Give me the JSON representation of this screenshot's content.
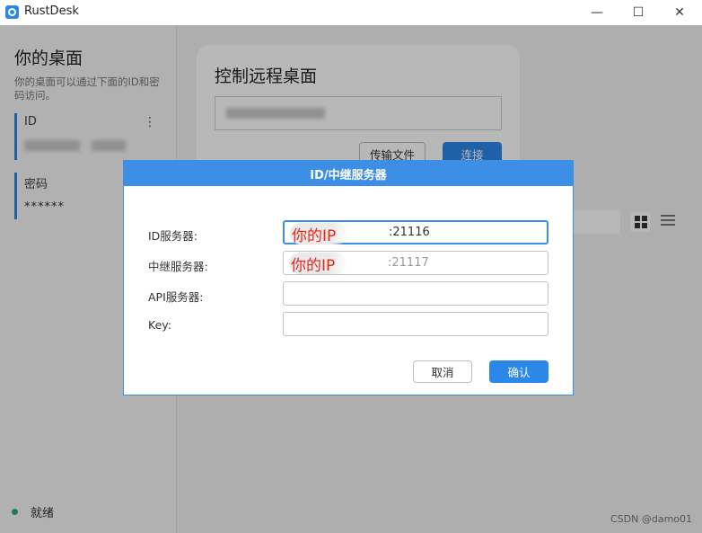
{
  "window": {
    "title": "RustDesk",
    "controls": {
      "minimize": "—",
      "maximize": "☐",
      "close": "✕"
    }
  },
  "left_panel": {
    "title": "你的桌面",
    "description": "你的桌面可以通过下面的ID和密码访问。",
    "id_label": "ID",
    "menu_icon": "⋮",
    "password_label": "密码",
    "password_value": "******"
  },
  "remote_card": {
    "title": "控制远程桌面",
    "transfer_button": "传输文件",
    "connect_button": "连接"
  },
  "status": {
    "text": "就绪",
    "color": "#2aa88a"
  },
  "watermark": "CSDN @damo01",
  "dialog": {
    "title": "ID/中继服务器",
    "rows": [
      {
        "label": "ID服务器:",
        "overlay": "你的IP",
        "port": ":21116",
        "focused": true
      },
      {
        "label": "中继服务器:",
        "overlay": "你的IP",
        "port": ":21117",
        "focused": false
      },
      {
        "label": "API服务器:",
        "value": ""
      },
      {
        "label": "Key:",
        "value": ""
      }
    ],
    "cancel_button": "取消",
    "ok_button": "确认"
  },
  "colors": {
    "accent": "#2b87e8",
    "dialog_header": "#3d8fe6",
    "highlight_text": "#e8251a"
  }
}
